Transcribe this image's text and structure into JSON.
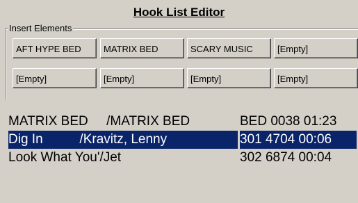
{
  "window": {
    "title": "Hook List Editor"
  },
  "insert_elements": {
    "label": "Insert Elements",
    "slots": [
      "AFT HYPE  BED",
      "MATRIX BED",
      "SCARY MUSIC",
      "[Empty]",
      "[Empty]",
      "[Empty]",
      "[Empty]",
      "[Empty]"
    ]
  },
  "hook_list": {
    "rows": [
      {
        "title_artist": "MATRIX BED     /MATRIX BED",
        "info": "BED 0038 01:23",
        "selected": false
      },
      {
        "title_artist": "Dig In          /Kravitz, Lenny",
        "info": "301 4704 00:06",
        "selected": true
      },
      {
        "title_artist": "Look What You'/Jet",
        "info": "302 6874 00:04",
        "selected": false
      }
    ]
  }
}
